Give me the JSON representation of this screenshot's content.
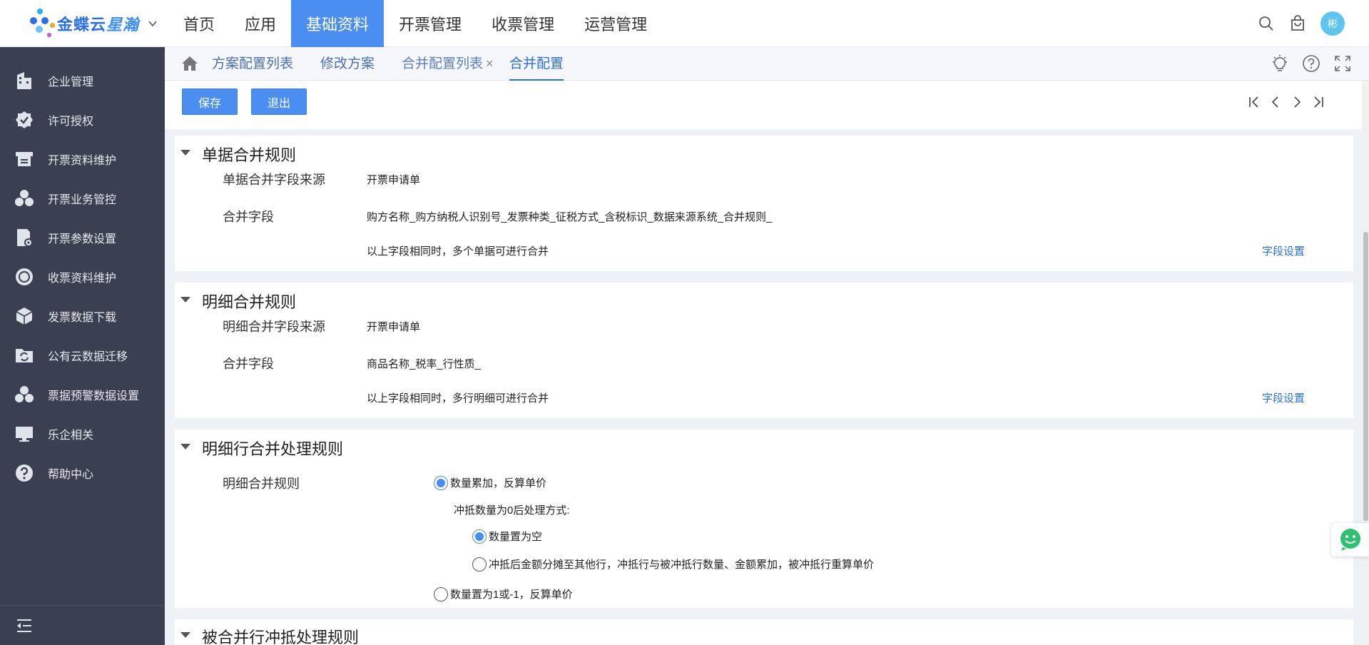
{
  "brand": {
    "name_part1": "金蝶云",
    "name_part2": "星瀚"
  },
  "nav": {
    "items": [
      {
        "label": "首页",
        "active": false
      },
      {
        "label": "应用",
        "active": false
      },
      {
        "label": "基础资料",
        "active": true
      },
      {
        "label": "开票管理",
        "active": false
      },
      {
        "label": "收票管理",
        "active": false
      },
      {
        "label": "运营管理",
        "active": false
      }
    ]
  },
  "user": {
    "avatar_text": "彬"
  },
  "sidebar": {
    "items": [
      {
        "label": "企业管理",
        "icon": "building-icon"
      },
      {
        "label": "许可授权",
        "icon": "badge-check-icon"
      },
      {
        "label": "开票资料维护",
        "icon": "printer-icon"
      },
      {
        "label": "开票业务管控",
        "icon": "cluster-icon"
      },
      {
        "label": "开票参数设置",
        "icon": "doc-gear-icon"
      },
      {
        "label": "收票资料维护",
        "icon": "circle-icon"
      },
      {
        "label": "发票数据下载",
        "icon": "cube-icon"
      },
      {
        "label": "公有云数据迁移",
        "icon": "folder-sync-icon"
      },
      {
        "label": "票据预警数据设置",
        "icon": "cluster-icon"
      },
      {
        "label": "乐企相关",
        "icon": "monitor-icon"
      },
      {
        "label": "帮助中心",
        "icon": "help-icon"
      }
    ]
  },
  "tabs": {
    "items": [
      {
        "label": "方案配置列表"
      },
      {
        "label": "修改方案"
      },
      {
        "label": "合并配置列表",
        "close": "×"
      },
      {
        "label": "合并配置"
      }
    ]
  },
  "toolbar": {
    "save_label": "保存",
    "exit_label": "退出"
  },
  "sections": {
    "bill": {
      "title": "单据合并规则",
      "source_label": "单据合并字段来源",
      "source_value": "开票申请单",
      "fields_label": "合并字段",
      "fields_value": "购方名称_购方纳税人识别号_发票种类_征税方式_含税标识_数据来源系统_合并规则_",
      "hint": "以上字段相同时，多个单据可进行合并",
      "link": "字段设置"
    },
    "detail": {
      "title": "明细合并规则",
      "source_label": "明细合并字段来源",
      "source_value": "开票申请单",
      "fields_label": "合并字段",
      "fields_value": "商品名称_税率_行性质_",
      "hint": "以上字段相同时，多行明细可进行合并",
      "link": "字段设置"
    },
    "line": {
      "title": "明细行合并处理规则",
      "rule_label": "明细合并规则",
      "option1": "数量累加，反算单价",
      "offset_label": "冲抵数量为0后处理方式:",
      "sub_option1": "数量置为空",
      "sub_option2": "冲抵后金额分摊至其他行，冲抵行与被冲抵行数量、金额累加，被冲抵行重算单价",
      "option2": "数量置为1或-1，反算单价"
    },
    "offset": {
      "title": "被合并行冲抵处理规则"
    }
  },
  "colors": {
    "accent": "#4a8ef2",
    "sidebar_bg": "#3a3f51",
    "link": "#2a6ee8"
  }
}
